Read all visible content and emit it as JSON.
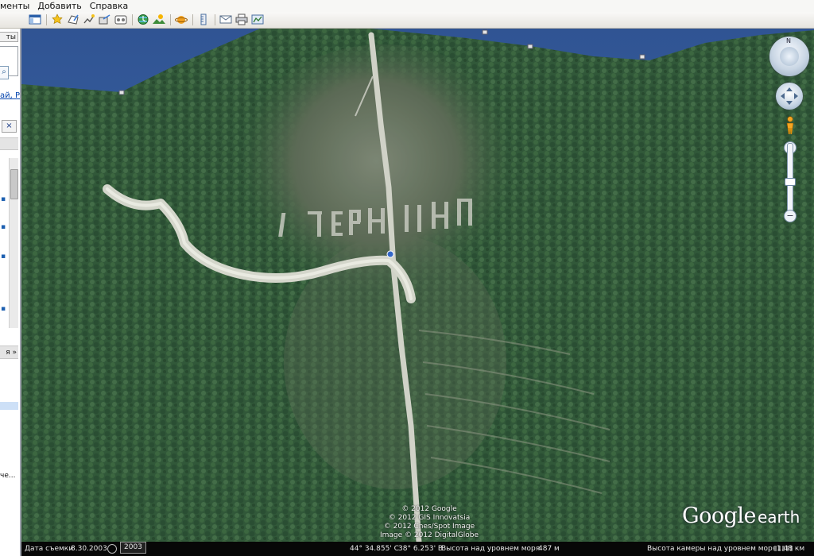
{
  "menubar": {
    "items": [
      "менты",
      "Добавить",
      "Справка"
    ]
  },
  "toolbar": {
    "icons": [
      "sidebar-toggle-icon",
      "placemark-icon",
      "polygon-icon",
      "path-icon",
      "image-overlay-icon",
      "tour-icon",
      "historical-imagery-icon",
      "sunlight-icon",
      "planets-icon",
      "ruler-icon",
      "email-icon",
      "print-icon",
      "view-in-maps-icon"
    ]
  },
  "sidebar": {
    "tab_label": "ты",
    "link_text": "ай, Рс",
    "close_glyph": "×",
    "layers_label": "я",
    "more_label": "че..."
  },
  "map": {
    "credits": [
      "© 2012 Google",
      "© 2012 GIS Innovatsia",
      "© 2012 Cnes/Spot Image",
      "Image © 2012 DigitalGlobe"
    ],
    "logo_google": "Google",
    "logo_earth": "earth",
    "nav": {
      "north_label": "N",
      "zoom_in": "+",
      "zoom_out": "−"
    },
    "zoom_level": 0.5,
    "colors": {
      "sky": "#2f5a9e",
      "forest": "#2f5a34",
      "slope": "#6f7a64",
      "road": "#cfd0c4"
    }
  },
  "statusbar": {
    "imagery_date_label": "Дата съемки",
    "imagery_date": "8.30.2003",
    "history_year": "2003",
    "latitude": "44° 34.855' С",
    "longitude": "38° 6.253' В",
    "elevation_label": "Высота над уровнем моря",
    "elevation": "487 м",
    "eye_alt_label": "Высота камеры над уровнем моря",
    "eye_alt": "1.48 км"
  }
}
